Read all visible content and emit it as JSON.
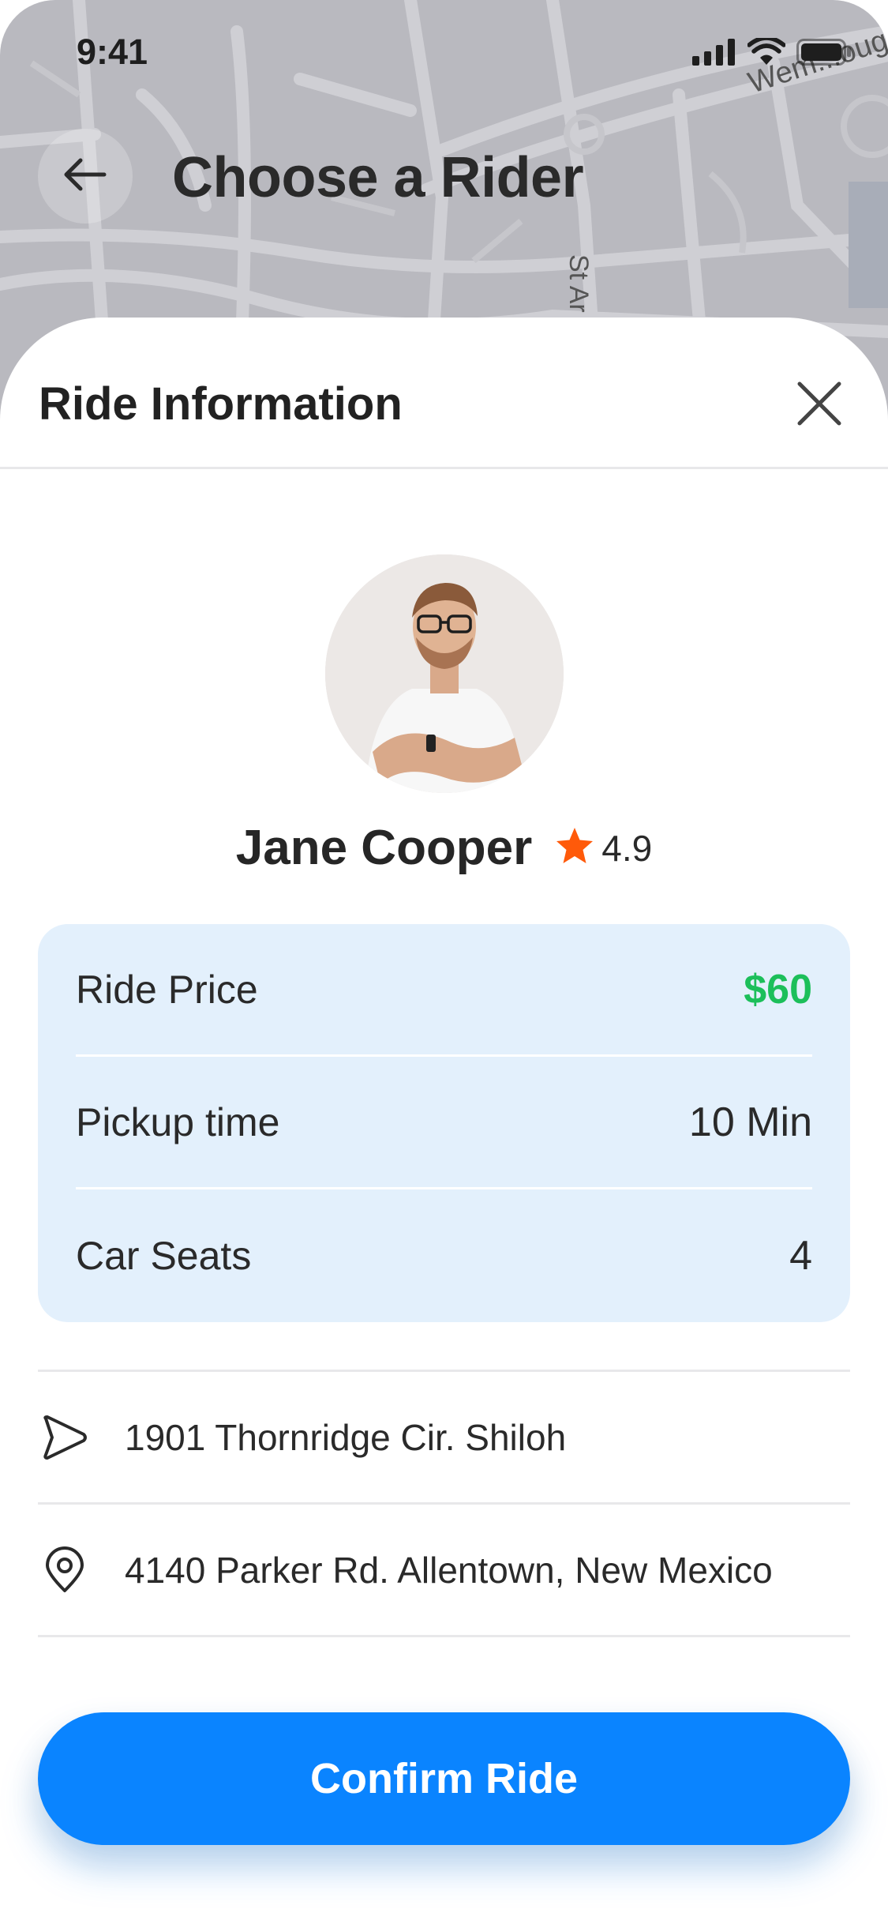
{
  "status_bar": {
    "time": "9:41"
  },
  "map": {
    "street_top": "Wem...oug",
    "street_vertical": "St Ar"
  },
  "header": {
    "title": "Choose a Rider"
  },
  "sheet": {
    "title": "Ride Information"
  },
  "driver": {
    "name": "Jane Cooper",
    "rating": "4.9",
    "rating_icon": "star-icon",
    "rating_color": "#ff5a0a"
  },
  "ride_info": [
    {
      "label": "Ride Price",
      "value": "$60",
      "value_color": "#1cbf5a"
    },
    {
      "label": "Pickup time",
      "value": "10 Min"
    },
    {
      "label": "Car Seats",
      "value": "4"
    }
  ],
  "addresses": [
    {
      "icon": "navigation-arrow-icon",
      "text": "1901 Thornridge Cir. Shiloh"
    },
    {
      "icon": "location-pin-icon",
      "text": "4140 Parker Rd. Allentown, New Mexico"
    }
  ],
  "actions": {
    "confirm_label": "Confirm Ride",
    "confirm_color": "#0a84ff"
  }
}
